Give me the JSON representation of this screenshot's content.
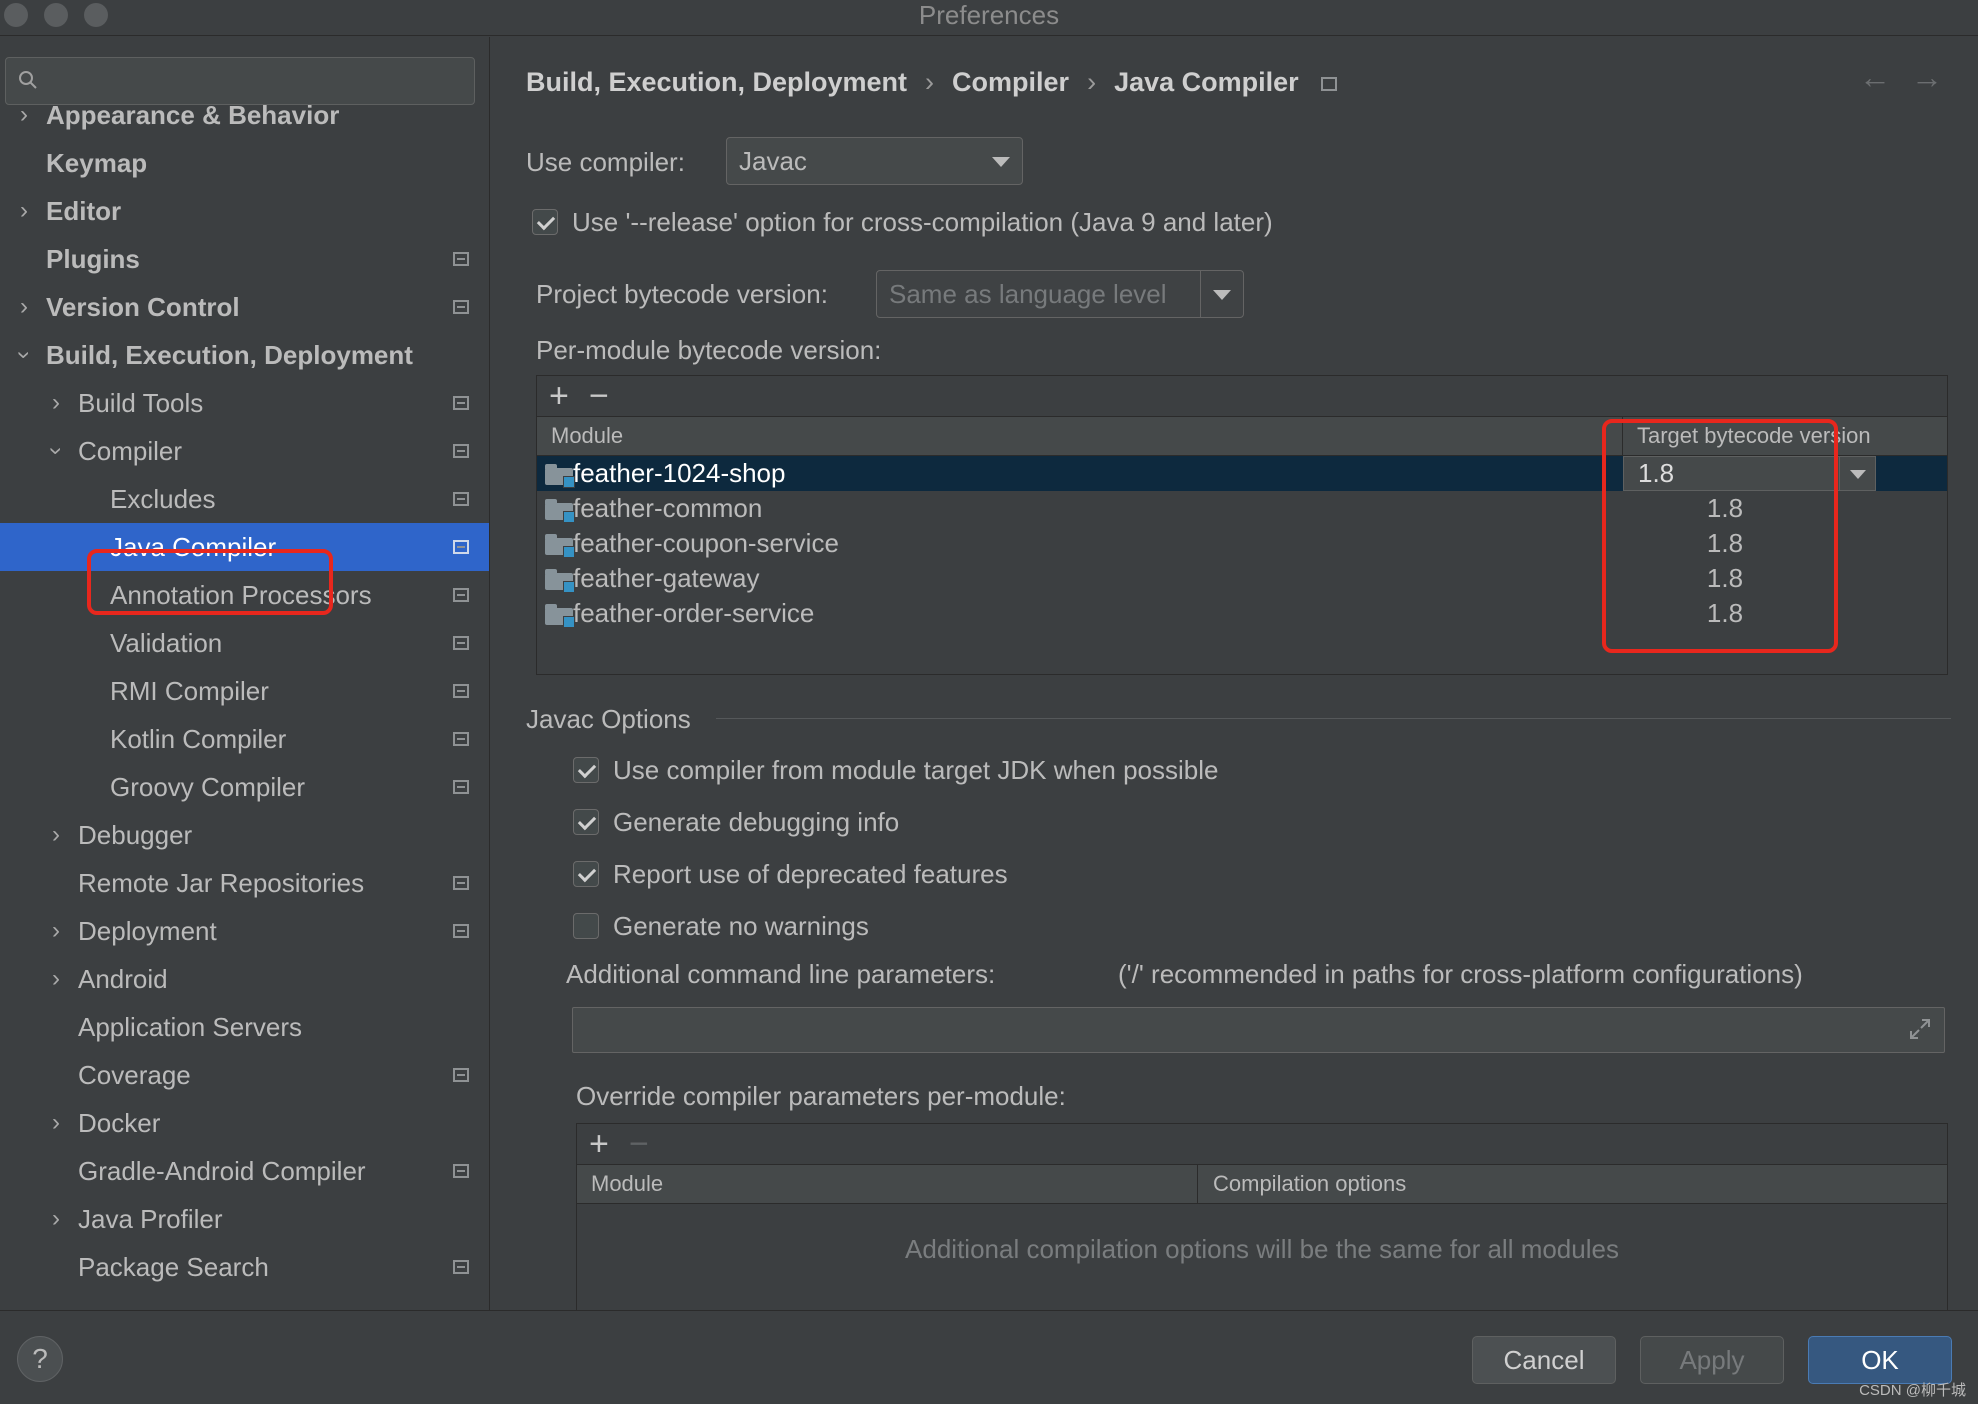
{
  "window": {
    "title": "Preferences"
  },
  "sidebar": {
    "search_placeholder": "",
    "items": [
      {
        "label": "Appearance & Behavior"
      },
      {
        "label": "Keymap"
      },
      {
        "label": "Editor"
      },
      {
        "label": "Plugins"
      },
      {
        "label": "Version Control"
      },
      {
        "label": "Build, Execution, Deployment"
      },
      {
        "label": "Build Tools"
      },
      {
        "label": "Compiler"
      },
      {
        "label": "Excludes"
      },
      {
        "label": "Java Compiler"
      },
      {
        "label": "Annotation Processors"
      },
      {
        "label": "Validation"
      },
      {
        "label": "RMI Compiler"
      },
      {
        "label": "Kotlin Compiler"
      },
      {
        "label": "Groovy Compiler"
      },
      {
        "label": "Debugger"
      },
      {
        "label": "Remote Jar Repositories"
      },
      {
        "label": "Deployment"
      },
      {
        "label": "Android"
      },
      {
        "label": "Application Servers"
      },
      {
        "label": "Coverage"
      },
      {
        "label": "Docker"
      },
      {
        "label": "Gradle-Android Compiler"
      },
      {
        "label": "Java Profiler"
      },
      {
        "label": "Package Search"
      }
    ]
  },
  "breadcrumb": {
    "items": [
      "Build, Execution, Deployment",
      "Compiler",
      "Java Compiler"
    ],
    "separator": "›",
    "back_icon": "←",
    "forward_icon": "→"
  },
  "compiler": {
    "use_compiler_label": "Use compiler:",
    "use_compiler_value": "Javac",
    "release_option_label": "Use '--release' option for cross-compilation (Java 9 and later)",
    "project_bytecode_label": "Project bytecode version:",
    "project_bytecode_value": "Same as language level",
    "per_module_label": "Per-module bytecode version:"
  },
  "module_table": {
    "add": "+",
    "remove": "−",
    "headers": {
      "module": "Module",
      "target": "Target bytecode version"
    },
    "rows": [
      {
        "module": "feather-1024-shop",
        "version": "1.8"
      },
      {
        "module": "feather-common",
        "version": "1.8"
      },
      {
        "module": "feather-coupon-service",
        "version": "1.8"
      },
      {
        "module": "feather-gateway",
        "version": "1.8"
      },
      {
        "module": "feather-order-service",
        "version": "1.8"
      }
    ]
  },
  "javac_options": {
    "title": "Javac Options",
    "checkboxes": [
      {
        "label": "Use compiler from module target JDK when possible",
        "checked": true
      },
      {
        "label": "Generate debugging info",
        "checked": true
      },
      {
        "label": "Report use of deprecated features",
        "checked": true
      },
      {
        "label": "Generate no warnings",
        "checked": false
      }
    ],
    "additional_params_label": "Additional command line parameters:",
    "additional_params_hint": "('/' recommended in paths for cross-platform configurations)",
    "additional_params_value": "",
    "override_label": "Override compiler parameters per-module:",
    "override_add": "+",
    "override_remove": "−",
    "override_headers": {
      "module": "Module",
      "options": "Compilation options"
    },
    "override_empty": "Additional compilation options will be the same for all modules"
  },
  "footer": {
    "help": "?",
    "cancel": "Cancel",
    "apply": "Apply",
    "ok": "OK",
    "watermark": "CSDN @柳千城"
  },
  "colors": {
    "accent": "#2f65ca",
    "highlight": "#e8271d",
    "primary_button": "#365880"
  }
}
